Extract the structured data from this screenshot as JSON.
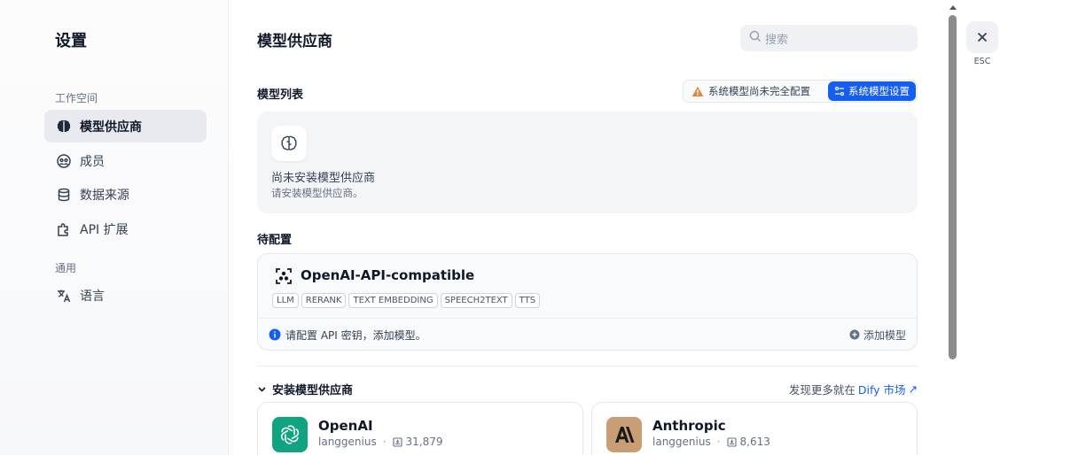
{
  "sidebar": {
    "title": "设置",
    "group_workspace": "工作空间",
    "group_general": "通用",
    "items": [
      {
        "label": "模型供应商",
        "icon": "brain-icon",
        "active": true
      },
      {
        "label": "成员",
        "icon": "members-icon",
        "active": false
      },
      {
        "label": "数据来源",
        "icon": "database-icon",
        "active": false
      },
      {
        "label": "API 扩展",
        "icon": "puzzle-icon",
        "active": false
      },
      {
        "label": "语言",
        "icon": "translate-icon",
        "active": false
      }
    ]
  },
  "main": {
    "title": "模型供应商",
    "search": {
      "placeholder": "搜索"
    },
    "model_list": {
      "title": "模型列表",
      "warning": "系统模型尚未完全配置",
      "system_settings_button": "系统模型设置",
      "empty_title": "尚未安装模型供应商",
      "empty_subtitle": "请安装模型供应商。"
    },
    "pending": {
      "title": "待配置",
      "provider": {
        "name": "OpenAI-API-compatible",
        "tags": [
          "LLM",
          "RERANK",
          "TEXT EMBEDDING",
          "SPEECH2TEXT",
          "TTS"
        ],
        "info": "请配置 API 密钥，添加模型。",
        "add_model": "添加模型"
      }
    },
    "install": {
      "title": "安装模型供应商",
      "market_prefix": "发现更多就在",
      "market_link": "Dify 市场",
      "market_arrow": "↗",
      "cards": [
        {
          "name": "OpenAI",
          "author": "langgenius",
          "installs": "31,879",
          "icon": "openai-icon",
          "color": "#10a37f"
        },
        {
          "name": "Anthropic",
          "author": "langgenius",
          "installs": "8,613",
          "icon": "anthropic-icon",
          "color": "#c99e75"
        }
      ]
    }
  },
  "close": {
    "esc_label": "ESC"
  },
  "colors": {
    "accent": "#155eef",
    "warning": "#dc8a43"
  }
}
